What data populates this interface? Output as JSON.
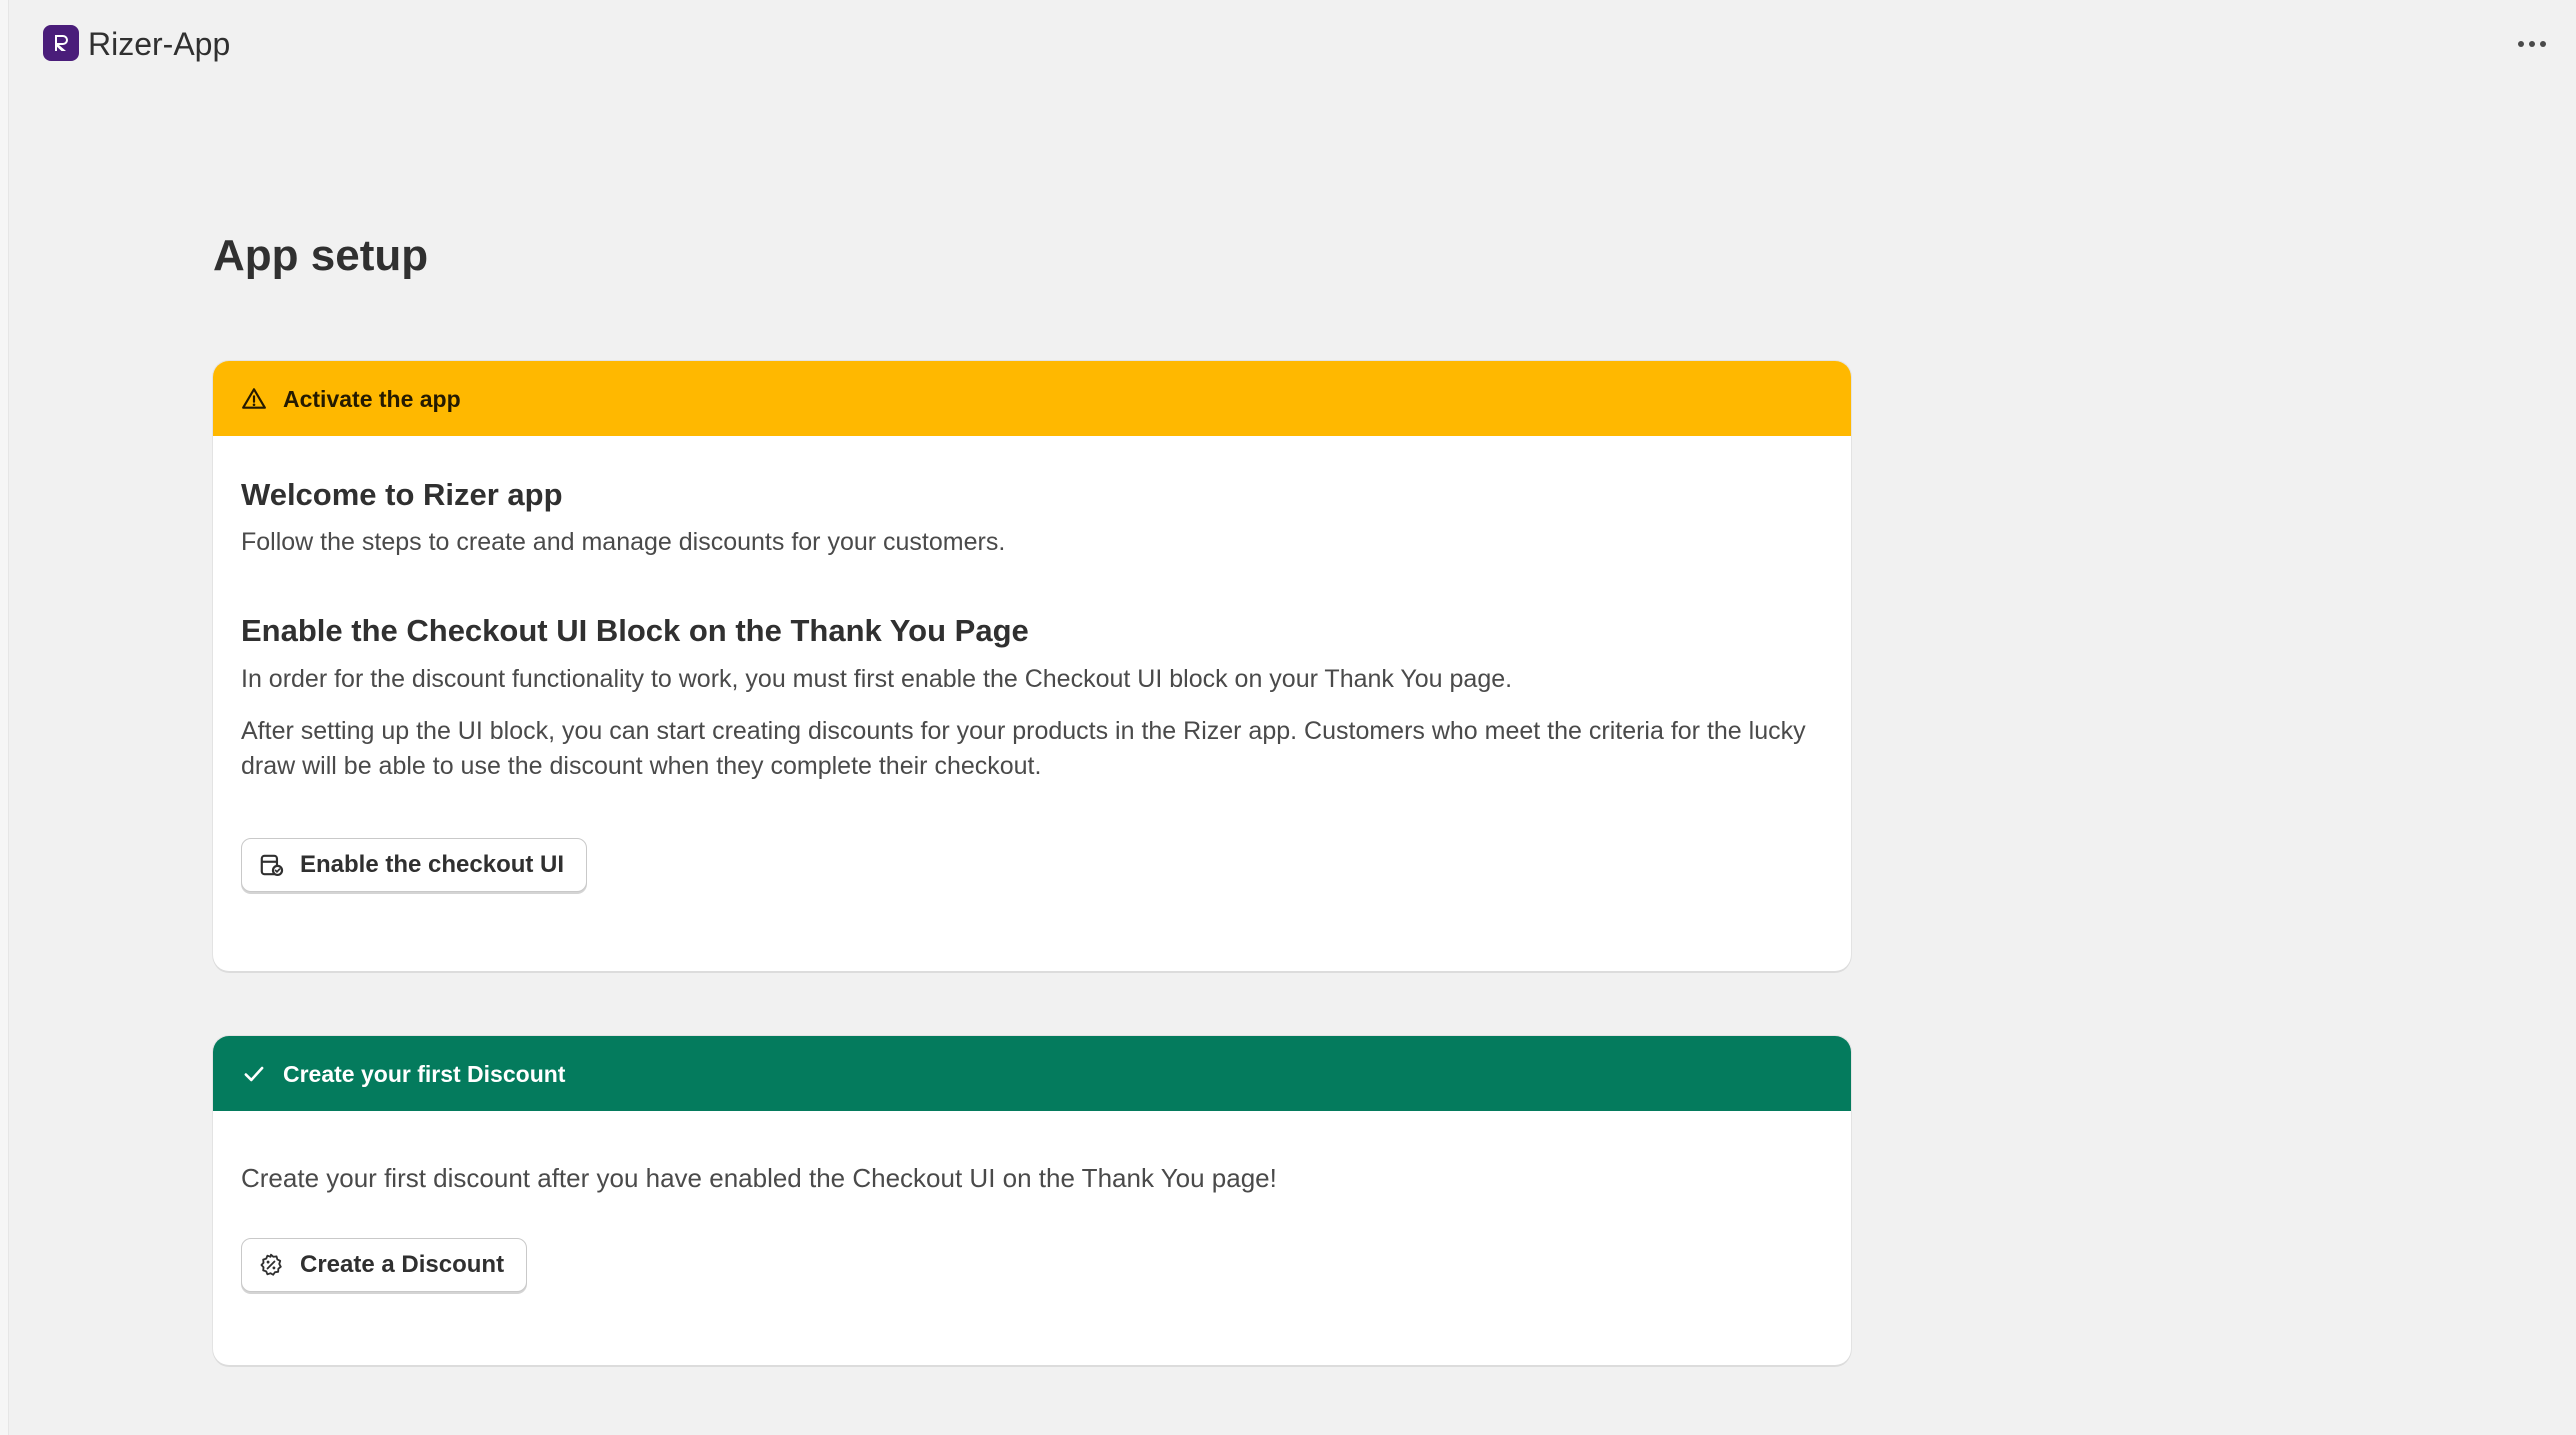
{
  "app": {
    "name": "Rizer-App",
    "logo_icon": "rizer-logo-icon",
    "brand_color": "#4a1d7a"
  },
  "header": {
    "more_icon": "more-horizontal-icon"
  },
  "page": {
    "title": "App setup"
  },
  "activate_card": {
    "banner": {
      "icon": "warning-triangle-icon",
      "label": "Activate the app",
      "color": "#ffb800"
    },
    "welcome_heading": "Welcome to Rizer app",
    "welcome_text": "Follow the steps to create and manage discounts for your customers.",
    "enable_heading": "Enable the Checkout UI Block on the Thank You Page",
    "enable_text_1": "In order for the discount functionality to work, you must first enable the Checkout UI block on your Thank You page.",
    "enable_text_2": "After setting up the UI block, you can start creating discounts for your products in the Rizer app. Customers who meet the criteria for the lucky draw will be able to use the discount when they complete their checkout.",
    "button": {
      "icon": "checkout-block-icon",
      "label": "Enable the checkout UI"
    }
  },
  "discount_card": {
    "banner": {
      "icon": "checkmark-icon",
      "label": "Create your first Discount",
      "color": "#047b5d"
    },
    "text": "Create your first discount after you have enabled the Checkout UI on the Thank You page!",
    "button": {
      "icon": "discount-badge-icon",
      "label": "Create a Discount"
    }
  }
}
